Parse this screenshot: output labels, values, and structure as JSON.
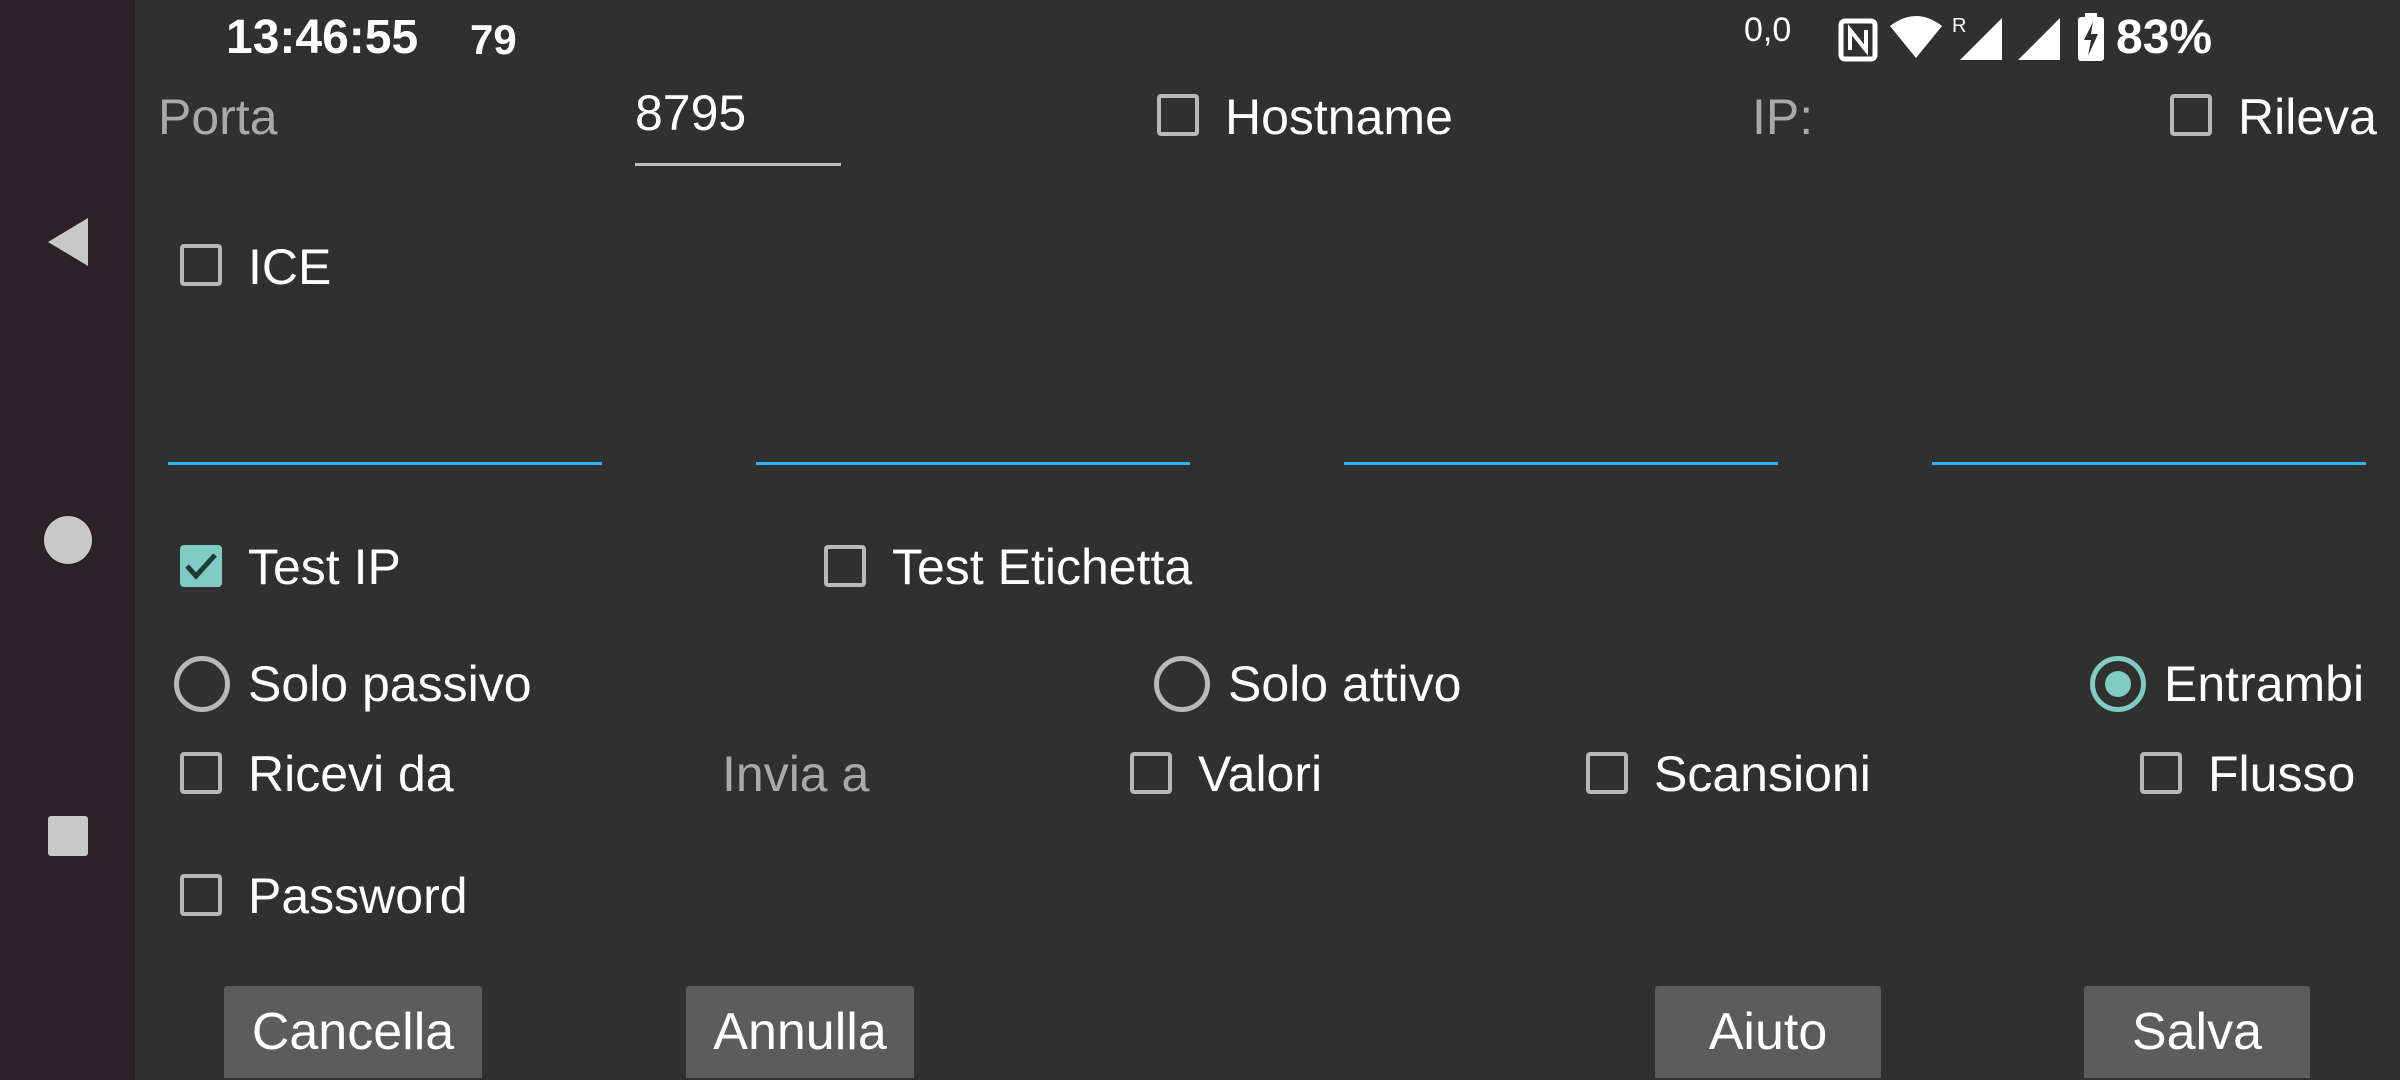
{
  "status_bar": {
    "time": "13:46:55",
    "notification": "79",
    "data_activity": "0,0",
    "battery": "83%",
    "icons": [
      "nfc-icon",
      "wifi-icon",
      "signal-roaming-icon",
      "signal-icon",
      "battery-charging-icon"
    ]
  },
  "nav": {
    "icons": [
      "back-icon",
      "home-icon",
      "recents-icon"
    ]
  },
  "row1": {
    "port_label": "Porta",
    "port_value": "8795",
    "hostname_label": "Hostname",
    "ip_label": "IP:",
    "detect_label": "Rileva"
  },
  "ice_label": "ICE",
  "test_ip_label": "Test IP",
  "test_label_label": "Test Etichetta",
  "mode": {
    "passive": "Solo passivo",
    "active": "Solo attivo",
    "both": "Entrambi",
    "selected": "both"
  },
  "row_options": {
    "receive_from": "Ricevi da",
    "send_to": "Invia a",
    "values": "Valori",
    "scans": "Scansioni",
    "stream": "Flusso"
  },
  "password_label": "Password",
  "buttons": {
    "delete": "Cancella",
    "cancel": "Annulla",
    "help": "Aiuto",
    "save": "Salva"
  },
  "colors": {
    "accent": "#80cbc4",
    "field_underline": "#29b6f6",
    "background": "#303030",
    "button": "#5c5c5c"
  }
}
